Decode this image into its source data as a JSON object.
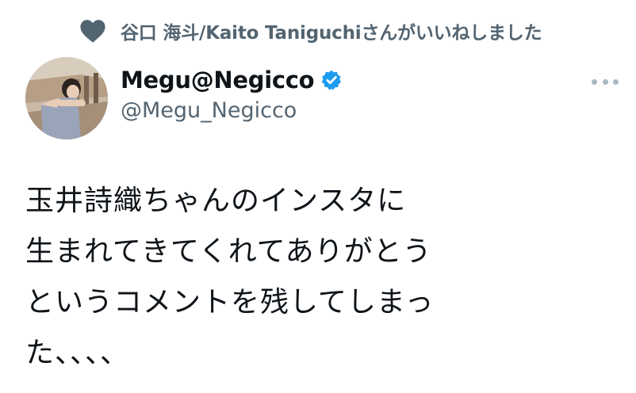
{
  "social_context": {
    "icon": "heart-icon",
    "text": "谷口 海斗/Kaito Taniguchiさんがいいねしました"
  },
  "author": {
    "display_name": "Megu@Negicco",
    "handle": "@Megu_Negicco",
    "verified": true,
    "verified_color": "#1d9bf0"
  },
  "more_icon": "more-icon",
  "tweet": {
    "lines": [
      "玉井詩織ちゃんのインスタに",
      "生まれてきてくれてありがとう",
      "というコメントを残してしまっ",
      "た、、、、"
    ]
  }
}
